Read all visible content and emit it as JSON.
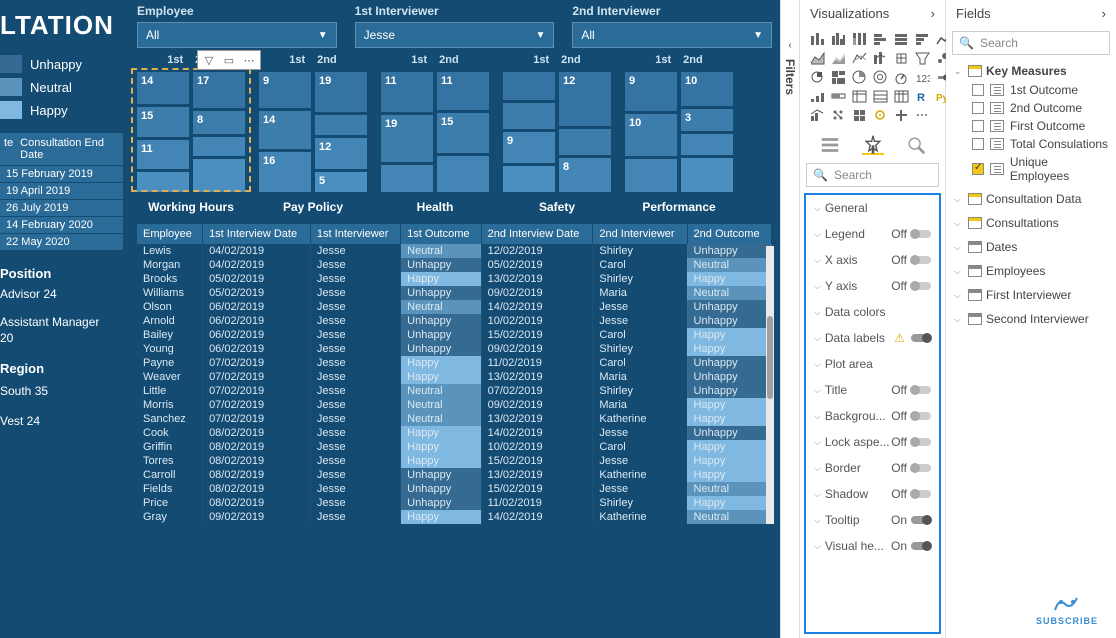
{
  "title": "LTATION",
  "legend": {
    "items": [
      "Unhappy",
      "Neutral",
      "Happy"
    ],
    "colors": [
      "#356a92",
      "#5a94bd",
      "#7fb8e0"
    ]
  },
  "dates_header_left": "te",
  "dates_header_right": "Consultation End Date",
  "dates": [
    "15 February 2019",
    "19 April 2019",
    "26 July 2019",
    "14 February 2020",
    "22 May 2020"
  ],
  "position_title": "Position",
  "position_value": "Advisor 24",
  "assistant_line1": "Assistant Manager",
  "assistant_line2": "20",
  "region_title": "Region",
  "region_value": "South 35",
  "region_value2": "Vest 24",
  "filters": {
    "employee": {
      "label": "Employee",
      "value": "All"
    },
    "int1": {
      "label": "1st Interviewer",
      "value": "Jesse"
    },
    "int2": {
      "label": "2nd Interviewer",
      "value": "All"
    }
  },
  "chart_data": [
    {
      "title": "Working Hours",
      "col_labels": [
        "1st",
        "2nd"
      ],
      "cols": [
        [
          {
            "v": 14,
            "h": 32
          },
          {
            "v": 15,
            "h": 30
          },
          {
            "v": 11,
            "h": 28
          },
          {
            "v": null,
            "h": 18
          }
        ],
        [
          {
            "v": 17,
            "h": 38
          },
          {
            "v": 8,
            "h": 22
          },
          {
            "v": null,
            "h": 16
          },
          {
            "v": null,
            "h": 34
          }
        ]
      ]
    },
    {
      "title": "Pay Policy",
      "col_labels": [
        "1st",
        "2nd"
      ],
      "cols": [
        [
          {
            "v": 9,
            "h": 28
          },
          {
            "v": 14,
            "h": 30
          },
          {
            "v": 16,
            "h": 32
          }
        ],
        [
          {
            "v": 19,
            "h": 40
          },
          {
            "v": null,
            "h": 16
          },
          {
            "v": 12,
            "h": 30
          },
          {
            "v": 5,
            "h": 16
          }
        ]
      ]
    },
    {
      "title": "Health",
      "col_labels": [
        "1st",
        "2nd"
      ],
      "cols": [
        [
          {
            "v": 11,
            "h": 32
          },
          {
            "v": 19,
            "h": 38
          },
          {
            "v": null,
            "h": 20
          }
        ],
        [
          {
            "v": 11,
            "h": 32
          },
          {
            "v": 15,
            "h": 34
          },
          {
            "v": null,
            "h": 30
          }
        ]
      ]
    },
    {
      "title": "Safety",
      "col_labels": [
        "1st",
        "2nd"
      ],
      "cols": [
        [
          {
            "v": null,
            "h": 22
          },
          {
            "v": null,
            "h": 20
          },
          {
            "v": 9,
            "h": 26
          },
          {
            "v": null,
            "h": 20
          }
        ],
        [
          {
            "v": 12,
            "h": 44
          },
          {
            "v": null,
            "h": 18
          },
          {
            "v": 8,
            "h": 26
          }
        ]
      ]
    },
    {
      "title": "Performance",
      "col_labels": [
        "1st",
        "2nd"
      ],
      "cols": [
        [
          {
            "v": 9,
            "h": 30
          },
          {
            "v": 10,
            "h": 32
          },
          {
            "v": null,
            "h": 24
          }
        ],
        [
          {
            "v": 10,
            "h": 30
          },
          {
            "v": 3,
            "h": 18
          },
          {
            "v": null,
            "h": 16
          },
          {
            "v": null,
            "h": 30
          }
        ]
      ]
    }
  ],
  "table": {
    "headers": [
      "Employee",
      "1st Interview Date",
      "1st Interviewer",
      "1st Outcome",
      "2nd Interview Date",
      "2nd Interviewer",
      "2nd Outcome"
    ],
    "rows": [
      [
        "Lewis",
        "04/02/2019",
        "Jesse",
        "Neutral",
        "12/02/2019",
        "Shirley",
        "Unhappy"
      ],
      [
        "Morgan",
        "04/02/2019",
        "Jesse",
        "Unhappy",
        "05/02/2019",
        "Carol",
        "Neutral"
      ],
      [
        "Brooks",
        "05/02/2019",
        "Jesse",
        "Happy",
        "13/02/2019",
        "Shirley",
        "Happy"
      ],
      [
        "Williams",
        "05/02/2019",
        "Jesse",
        "Unhappy",
        "09/02/2019",
        "Maria",
        "Neutral"
      ],
      [
        "Olson",
        "06/02/2019",
        "Jesse",
        "Neutral",
        "14/02/2019",
        "Jesse",
        "Unhappy"
      ],
      [
        "Arnold",
        "06/02/2019",
        "Jesse",
        "Unhappy",
        "10/02/2019",
        "Jesse",
        "Unhappy"
      ],
      [
        "Bailey",
        "06/02/2019",
        "Jesse",
        "Unhappy",
        "15/02/2019",
        "Carol",
        "Happy"
      ],
      [
        "Young",
        "06/02/2019",
        "Jesse",
        "Unhappy",
        "09/02/2019",
        "Shirley",
        "Happy"
      ],
      [
        "Payne",
        "07/02/2019",
        "Jesse",
        "Happy",
        "11/02/2019",
        "Carol",
        "Unhappy"
      ],
      [
        "Weaver",
        "07/02/2019",
        "Jesse",
        "Happy",
        "13/02/2019",
        "Maria",
        "Unhappy"
      ],
      [
        "Little",
        "07/02/2019",
        "Jesse",
        "Neutral",
        "07/02/2019",
        "Shirley",
        "Unhappy"
      ],
      [
        "Morris",
        "07/02/2019",
        "Jesse",
        "Neutral",
        "09/02/2019",
        "Maria",
        "Happy"
      ],
      [
        "Sanchez",
        "07/02/2019",
        "Jesse",
        "Neutral",
        "13/02/2019",
        "Katherine",
        "Happy"
      ],
      [
        "Cook",
        "08/02/2019",
        "Jesse",
        "Happy",
        "14/02/2019",
        "Jesse",
        "Unhappy"
      ],
      [
        "Griffin",
        "08/02/2019",
        "Jesse",
        "Happy",
        "10/02/2019",
        "Carol",
        "Happy"
      ],
      [
        "Torres",
        "08/02/2019",
        "Jesse",
        "Happy",
        "15/02/2019",
        "Jesse",
        "Happy"
      ],
      [
        "Carroll",
        "08/02/2019",
        "Jesse",
        "Unhappy",
        "13/02/2019",
        "Katherine",
        "Happy"
      ],
      [
        "Fields",
        "08/02/2019",
        "Jesse",
        "Unhappy",
        "15/02/2019",
        "Jesse",
        "Neutral"
      ],
      [
        "Price",
        "08/02/2019",
        "Jesse",
        "Unhappy",
        "11/02/2019",
        "Shirley",
        "Happy"
      ],
      [
        "Gray",
        "09/02/2019",
        "Jesse",
        "Happy",
        "14/02/2019",
        "Katherine",
        "Neutral"
      ]
    ]
  },
  "filters_tab": "Filters",
  "viz_header": "Visualizations",
  "format_search": "Search",
  "format_items": [
    {
      "name": "General",
      "toggle": null
    },
    {
      "name": "Legend",
      "toggle": "Off"
    },
    {
      "name": "X axis",
      "toggle": "Off"
    },
    {
      "name": "Y axis",
      "toggle": "Off"
    },
    {
      "name": "Data colors",
      "toggle": null
    },
    {
      "name": "Data labels",
      "toggle": "warn-on"
    },
    {
      "name": "Plot area",
      "toggle": null
    },
    {
      "name": "Title",
      "toggle": "Off"
    },
    {
      "name": "Backgrou...",
      "toggle": "Off"
    },
    {
      "name": "Lock aspe...",
      "toggle": "Off"
    },
    {
      "name": "Border",
      "toggle": "Off"
    },
    {
      "name": "Shadow",
      "toggle": "Off"
    },
    {
      "name": "Tooltip",
      "toggle": "On"
    },
    {
      "name": "Visual he...",
      "toggle": "On"
    }
  ],
  "fields_header": "Fields",
  "fields_search": "Search",
  "field_groups": [
    {
      "name": "Key Measures",
      "expanded": true,
      "type": "measure",
      "fields": [
        {
          "name": "1st Outcome",
          "checked": false
        },
        {
          "name": "2nd Outcome",
          "checked": false
        },
        {
          "name": "First Outcome",
          "checked": false
        },
        {
          "name": "Total Consulations",
          "checked": false
        },
        {
          "name": "Unique Employees",
          "checked": true
        }
      ]
    },
    {
      "name": "Consultation Data",
      "expanded": false,
      "type": "measure"
    },
    {
      "name": "Consultations",
      "expanded": false,
      "type": "measure"
    },
    {
      "name": "Dates",
      "expanded": false,
      "type": "table"
    },
    {
      "name": "Employees",
      "expanded": false,
      "type": "table"
    },
    {
      "name": "First Interviewer",
      "expanded": false,
      "type": "table"
    },
    {
      "name": "Second Interviewer",
      "expanded": false,
      "type": "table"
    }
  ],
  "subscribe": "SUBSCRIBE"
}
